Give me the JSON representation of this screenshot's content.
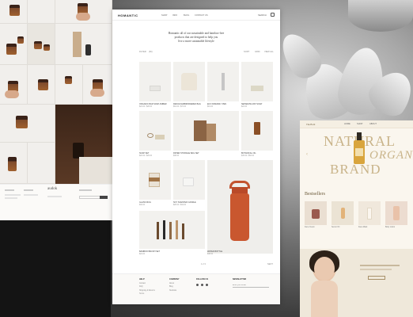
{
  "left": {
    "footer": {
      "brand": "audok"
    }
  },
  "store": {
    "logo": "HOMANTIC",
    "nav": [
      "SHOP",
      "INFO",
      "BLOG",
      "CONTACT US"
    ],
    "cart_icon": "bag-icon",
    "hero": [
      "Homantic all of our sustainable and bamboo-free",
      "products that are designed to help you",
      "live a more sustainable lifestyle"
    ],
    "filter": {
      "left": "FILTER",
      "count": "(60)",
      "sort": "SORT",
      "grid": "GRID",
      "view": "VIEW ALL"
    },
    "products": [
      {
        "name": "ORGANIC BAR SOAP AMBER",
        "price": "$24.00 / $28.00"
      },
      {
        "name": "DESIGN EMBROIDERED BAG",
        "price": "$64.00 / $72.00"
      },
      {
        "name": "ECO FRIENDLY PEN",
        "price": "$19.00"
      },
      {
        "name": "SEPARATE MAT SOAP",
        "price": "$22.00"
      },
      {
        "name": "SOAP SET",
        "price": "$22.00 / $26.00"
      },
      {
        "name": "PAPER STORAGE BAG SET",
        "price": "$38.00"
      },
      {
        "name": "BOTANICAL OIL",
        "price": "$45.00 / $52.00"
      },
      {
        "name": "GLASS MUG",
        "price": "$32.00"
      },
      {
        "name": "SOY SCENTED CANDLE",
        "price": "$28.00 / $34.00"
      },
      {
        "name": "WATER BOTTLE",
        "price": "$48.00"
      },
      {
        "name": "BAMBOO BRUSH SET",
        "price": "$24.00"
      },
      {
        "name": "CUP SET WATER",
        "price": "$36.00"
      }
    ],
    "pagination": {
      "pages": "1  2  3",
      "next": "NEXT"
    },
    "footer": {
      "col1": {
        "title": "HELP",
        "items": [
          "Contact",
          "FAQ",
          "Shipping & Returns",
          "Terms"
        ]
      },
      "col2": {
        "title": "COMPANY",
        "items": [
          "About",
          "Blog",
          "Stockists"
        ]
      },
      "col3": {
        "title": "FOLLOW US"
      },
      "col4": {
        "title": "NEWSLETTER",
        "placeholder": "Enter your email"
      }
    }
  },
  "cos": {
    "logo": "The Bold",
    "nav": [
      "HOME",
      "SHOP",
      "ABOUT"
    ],
    "headline": [
      "NATURAL",
      "ORGANIC",
      "BRAND"
    ],
    "bestsellers": "Bestsellers",
    "products": [
      "Face Cream",
      "Serum Oil",
      "Face Mask",
      "Body Lotion"
    ]
  }
}
